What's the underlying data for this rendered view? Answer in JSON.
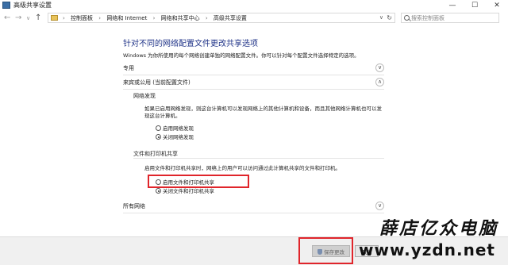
{
  "window": {
    "title": "高级共享设置",
    "minimize": "—",
    "maximize": "☐",
    "close": "✕"
  },
  "nav": {
    "back": "←",
    "forward": "→",
    "up_dropdown": "∨",
    "up": "↑",
    "breadcrumbs": [
      "控制面板",
      "网络和 Internet",
      "网络和共享中心",
      "高级共享设置"
    ],
    "address_dropdown": "∨",
    "refresh": "↻",
    "search_placeholder": "搜索控制面板"
  },
  "page": {
    "title": "针对不同的网络配置文件更改共享选项",
    "description": "Windows 为你所使用的每个网络创建单独的网络配置文件。你可以针对每个配置文件选择特定的选项。"
  },
  "sections": {
    "private": {
      "label": "专用",
      "toggle": "∨"
    },
    "guest": {
      "label": "来宾或公用 (当前配置文件)",
      "toggle": "∧"
    },
    "all": {
      "label": "所有网络",
      "toggle": "∨"
    }
  },
  "discovery": {
    "title": "网络发现",
    "text": "如果已启用网络发现，则这台计算机可以发现网络上的其他计算机和设备，而且其他网络计算机也可以发现这台计算机。",
    "options": [
      "启用网络发现",
      "关闭网络发现"
    ],
    "selected": "关闭网络发现"
  },
  "sharing": {
    "title": "文件和打印机共享",
    "text": "启用文件和打印机共享时，网络上的用户可以访问通过此计算机共享的文件和打印机。",
    "options": [
      "启用文件和打印机共享",
      "关闭文件和打印机共享"
    ],
    "selected": "关闭文件和打印机共享"
  },
  "buttons": {
    "save": "保存更改",
    "cancel": "取消"
  },
  "watermark": {
    "brand": "薛店亿众电脑",
    "url": "www.yzdn.net"
  },
  "colors": {
    "title_blue": "#1e3287",
    "highlight_red": "#e0252b"
  }
}
